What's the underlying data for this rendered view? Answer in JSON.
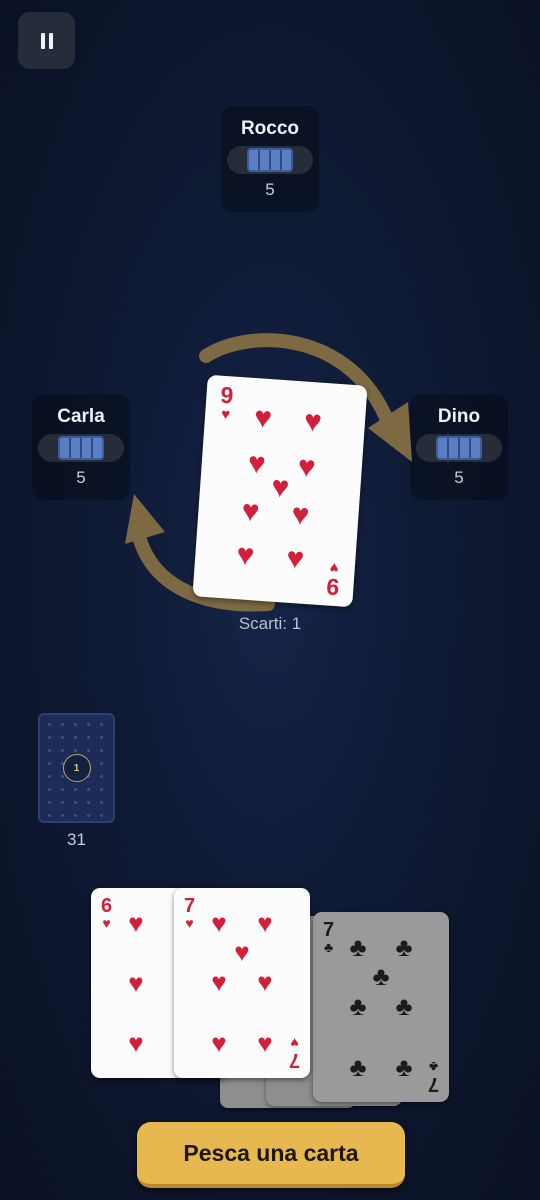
{
  "pause_icon": "pause-icon",
  "opponents": [
    {
      "name": "Rocco",
      "cards": "5"
    },
    {
      "name": "Carla",
      "cards": "5"
    },
    {
      "name": "Dino",
      "cards": "5"
    }
  ],
  "discard": {
    "rank": "9",
    "suit": "hearts",
    "label": "Scarti: 1"
  },
  "deck": {
    "badge": "1",
    "count": "31"
  },
  "hand": [
    {
      "rank": "6",
      "suit": "hearts"
    },
    {
      "rank": "7",
      "suit": "hearts"
    },
    {
      "rank": "7",
      "suit": "clubs"
    }
  ],
  "draw_button": {
    "label": "Pesca una carta"
  },
  "colors": {
    "background": "#0f1a35",
    "accent_button": "#e8b850",
    "arrow": "#7d6a42",
    "heart_red": "#d21f3a",
    "card_back": "#1d2c57"
  }
}
